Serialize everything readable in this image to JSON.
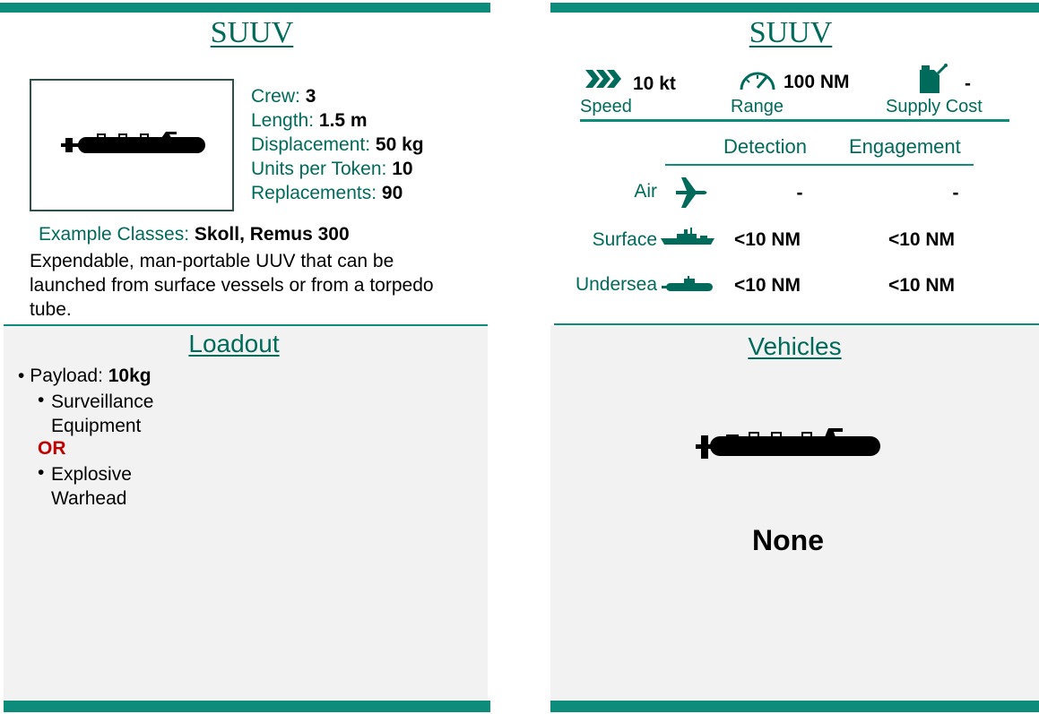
{
  "left": {
    "title": "SUUV",
    "stats": [
      {
        "label": "Crew: ",
        "value": "3"
      },
      {
        "label": "Length: ",
        "value": "1.5 m"
      },
      {
        "label": "Displacement: ",
        "value": "50 kg"
      },
      {
        "label": "Units per Token: ",
        "value": "10"
      },
      {
        "label": "Replacements: ",
        "value": "90"
      }
    ],
    "example_label": "Example Classes: ",
    "example_value": "Skoll, Remus 300",
    "description": "Expendable, man-portable UUV that can be launched from surface vessels or from a torpedo tube.",
    "loadout": {
      "title": "Loadout",
      "payload_label": "Payload: ",
      "payload_value": "10kg",
      "option1": "Surveillance Equipment",
      "or_label": "OR",
      "option2": "Explosive Warhead"
    }
  },
  "right": {
    "title": "SUUV",
    "speed": {
      "value": "10 kt",
      "label": "Speed",
      "icon": "chevrons-icon"
    },
    "range": {
      "value": "100 NM",
      "label": "Range",
      "icon": "speedometer-icon"
    },
    "supply": {
      "value": "-",
      "label": "Supply Cost",
      "icon": "fuel-can-icon"
    },
    "table": {
      "headers": [
        "Detection",
        "Engagement"
      ],
      "rows": [
        {
          "label": "Air",
          "icon": "airplane-icon",
          "detection": "-",
          "engagement": "-"
        },
        {
          "label": "Surface",
          "icon": "ship-icon",
          "detection": "<10 NM",
          "engagement": "<10 NM"
        },
        {
          "label": "Undersea",
          "icon": "submarine-icon",
          "detection": "<10 NM",
          "engagement": "<10 NM"
        }
      ]
    },
    "vehicles": {
      "title": "Vehicles",
      "value": "None"
    }
  },
  "colors": {
    "accent": "#0e8c7b",
    "text_accent": "#006b5b",
    "or_red": "#c00000",
    "panel": "#f2f2f2"
  }
}
